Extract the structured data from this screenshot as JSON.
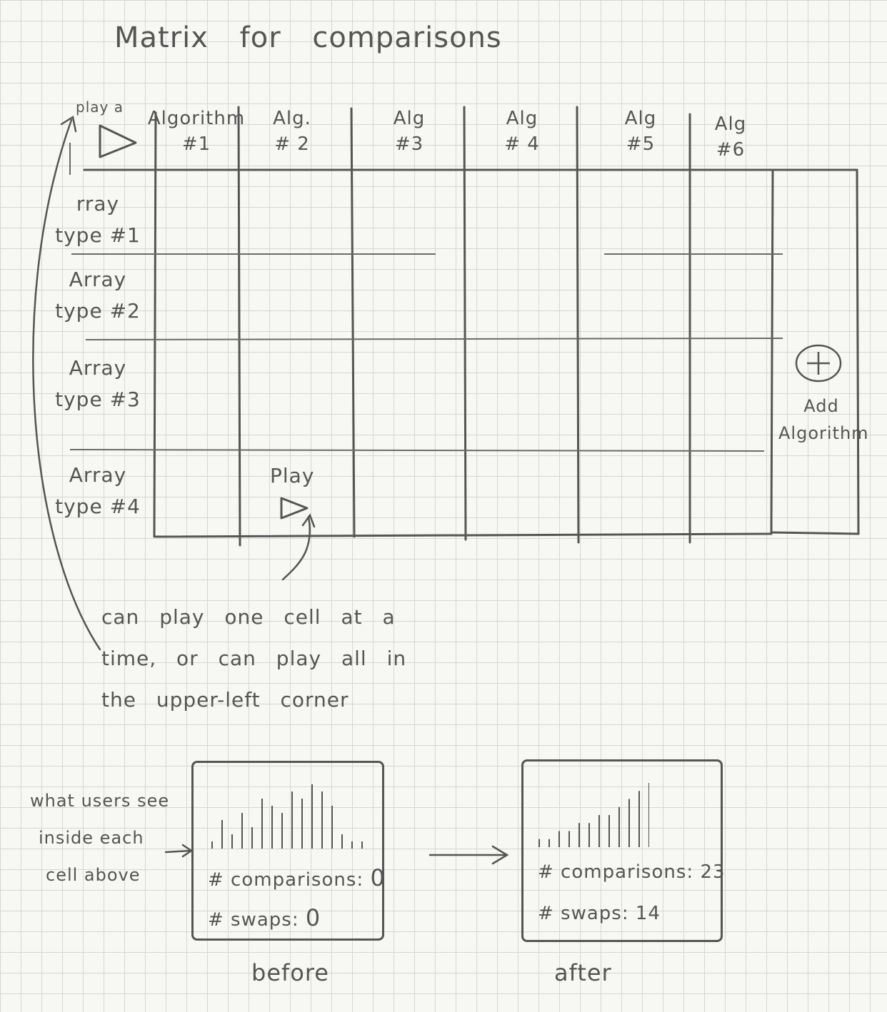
{
  "title": "Matrix for comparisons",
  "corner": {
    "label": "play a"
  },
  "columns": [
    "Algorithm #1",
    "Alg. # 2",
    "Alg #3",
    "Alg #4",
    "Alg #5",
    "Alg #6"
  ],
  "column_lines": [
    [
      "Algorithm",
      "#1"
    ],
    [
      "Alg.",
      "# 2"
    ],
    [
      "Alg",
      "#3"
    ],
    [
      "Alg",
      "# 4"
    ],
    [
      "Alg",
      "#5"
    ],
    [
      "Alg",
      "#6"
    ]
  ],
  "rows": [
    [
      "rray",
      "type #1"
    ],
    [
      "Array",
      "type #2"
    ],
    [
      "Array",
      "type #3"
    ],
    [
      "Array",
      "type #4"
    ]
  ],
  "cell_play_label": "Play",
  "add_algorithm": {
    "icon": "plus-icon",
    "line1": "Add",
    "line2": "Algorithm"
  },
  "note": [
    "can play one cell at a",
    "time, or can play all in",
    "the upper-left corner"
  ],
  "cells_label": [
    "what users see",
    "inside each",
    "cell above"
  ],
  "before": {
    "comparisons_label": "# comparisons:",
    "comparisons": "0",
    "swaps_label": "# swaps:",
    "swaps": "0",
    "bars": [
      1,
      4,
      2,
      5,
      3,
      7,
      6,
      5,
      8,
      7,
      9,
      8,
      6,
      2,
      1,
      1
    ],
    "caption": "before"
  },
  "after": {
    "comparisons_label": "# comparisons:",
    "comparisons": "23",
    "swaps_label": "# swaps:",
    "swaps": "14",
    "bars": [
      1,
      1,
      2,
      2,
      3,
      3,
      4,
      4,
      5,
      6,
      7,
      8
    ],
    "caption": "after"
  },
  "colors": {
    "ink": "#555555",
    "grid": "#d6d6d2",
    "paper": "#f7f7f4"
  }
}
